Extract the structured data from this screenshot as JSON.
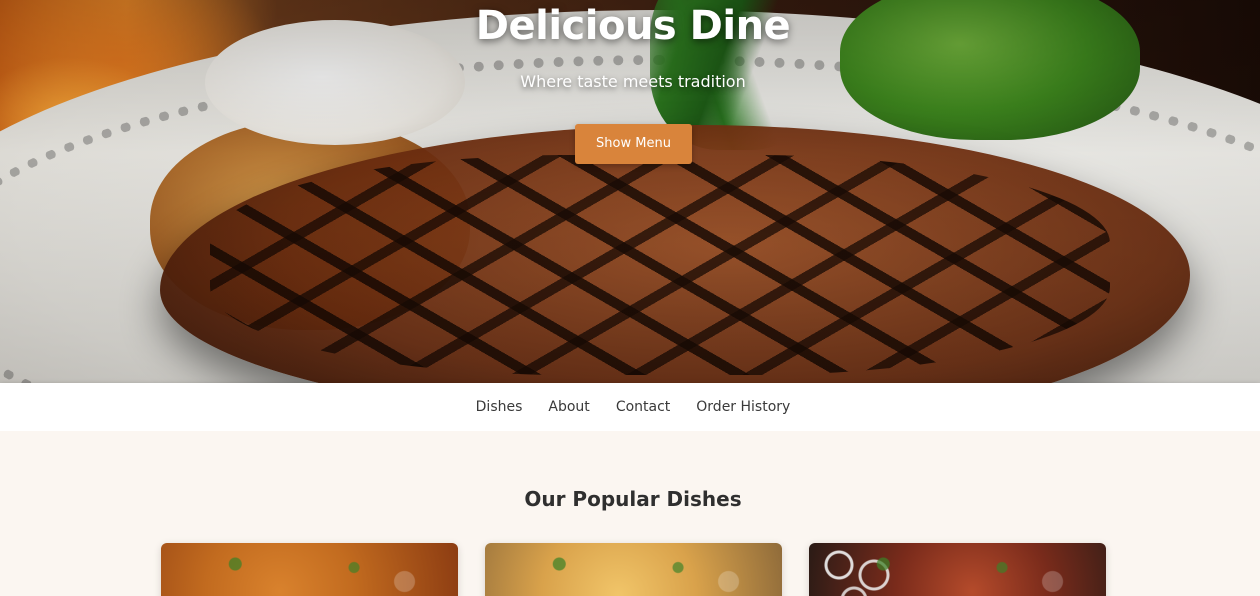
{
  "hero": {
    "title": "Delicious Dine",
    "subtitle": "Where taste meets tradition",
    "cta_label": "Show Menu",
    "cta_color": "#d9843b"
  },
  "nav": {
    "items": [
      {
        "label": "Dishes"
      },
      {
        "label": "About"
      },
      {
        "label": "Contact"
      },
      {
        "label": "Order History"
      }
    ]
  },
  "popular": {
    "title": "Our Popular Dishes"
  },
  "colors": {
    "page_background": "#fbf6f1",
    "nav_background": "#ffffff",
    "text_dark": "#2f2f2f"
  }
}
